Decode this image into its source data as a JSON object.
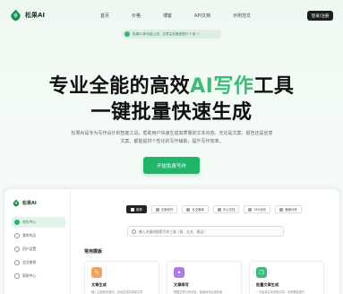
{
  "nav": {
    "brand": "松果AI",
    "links": [
      "首页",
      "价格",
      "博客",
      "API文档",
      "示例范文"
    ],
    "login": "登录/注册"
  },
  "hero": {
    "announcement": "松果AI 新功能上线，文章生成速度提升 3 倍 →",
    "title_line1_pre": "专业全能的高效",
    "title_line1_accent": "AI写作",
    "title_line1_post": "工具",
    "title_line2": "一键批量快速生成",
    "description": "松果AI是专为写作设计的智能工具，帮助用户快速生成高质量的文本内容。无论是文案、报告还是创意文案，都能提供个性化的写作辅助，提升写作效率。",
    "cta": "开始免费写作"
  },
  "app": {
    "brand": "松果AI",
    "sidebar": [
      "创作中心",
      "我的作品",
      "用户设置",
      "会员套餐",
      "帮助中心"
    ],
    "tabs": [
      "推荐",
      "文案创作",
      "社交媒体",
      "办公文档",
      "SEO优化",
      "营销分析"
    ],
    "search_placeholder": "输入关键词搜索写作工具（如：论文、报告）",
    "section_title": "常用模板",
    "cards": [
      {
        "icon": "pen-icon",
        "title": "文章生成",
        "desc": "输入主题和关键词，自动生成高质量文章",
        "color": "#f0a35c"
      },
      {
        "icon": "magic-icon",
        "title": "文章续写",
        "desc": "根据文章已有内容，智能续写后续段落",
        "color": "#a97ee6"
      },
      {
        "icon": "batch-icon",
        "title": "批量文章生成",
        "desc": "一次批量生成多篇文章，效率翻倍提升",
        "color": "#3dbb7a"
      }
    ]
  },
  "colors": {
    "accent": "#3dbb7a",
    "cta": "#20b56b",
    "dark": "#1c1f1e"
  }
}
